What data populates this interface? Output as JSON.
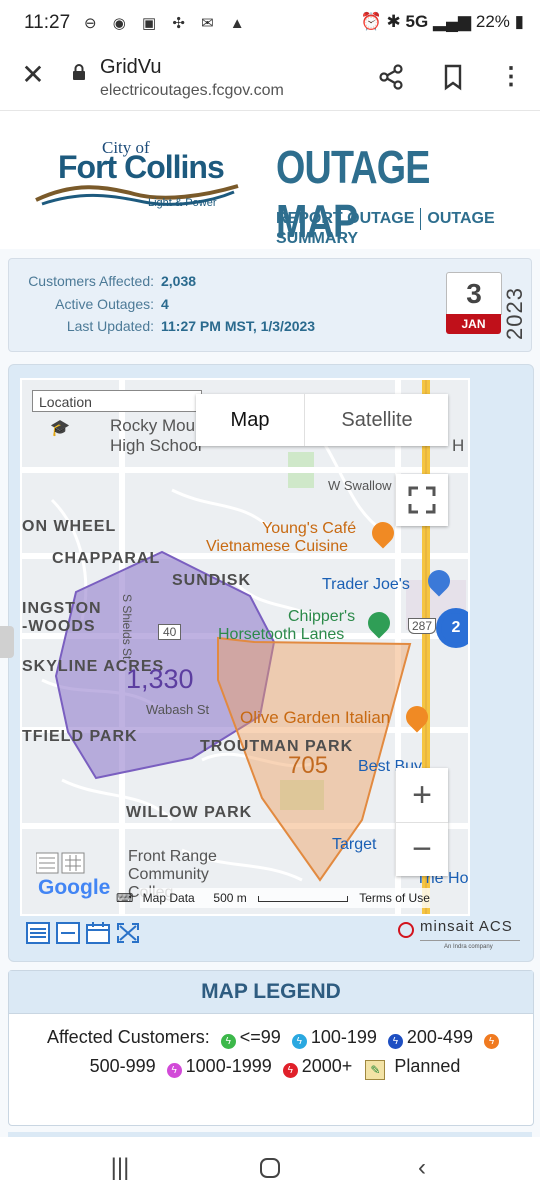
{
  "status_bar": {
    "time": "11:27",
    "network": "5G",
    "battery": "22%"
  },
  "browser": {
    "title": "GridVu",
    "url": "electricoutages.fcgov.com"
  },
  "header": {
    "logo_city": "City of",
    "logo_name": "Fort Collins",
    "logo_sub": "Light & Power",
    "title": "OUTAGE MAP",
    "links": [
      "REPORT OUTAGE",
      "OUTAGE SUMMARY"
    ]
  },
  "summary": {
    "customers_affected_label": "Customers Affected:",
    "customers_affected": "2,038",
    "active_outages_label": "Active Outages:",
    "active_outages": "4",
    "last_updated_label": "Last Updated:",
    "last_updated": "11:27 PM MST, 1/3/2023",
    "calendar_day": "3",
    "calendar_month": "JAN",
    "year": "2023"
  },
  "map": {
    "location_placeholder": "Location",
    "type_map": "Map",
    "type_satellite": "Satellite",
    "zoom_in": "+",
    "zoom_out": "−",
    "outages": [
      {
        "count": "1,330",
        "color": "#8a73c9"
      },
      {
        "count": "705",
        "color": "#f0a060"
      }
    ],
    "cluster_count": "2",
    "labels": {
      "rocky_mountain": "Rocky Mounta",
      "high_school": "High School",
      "w_swallow": "W Swallow R",
      "n_wheel": "ON WHEEL",
      "chapparal": "CHAPPARAL",
      "sundisk": "SUNDISK",
      "ingston": "INGSTON",
      "woods": "-WOODS",
      "skyline": "SKYLINE ACRES",
      "shields": "S Shields St",
      "route40": "40",
      "route287": "287",
      "wabash": "Wabash St",
      "field_park": "TFIELD PARK",
      "troutman": "TROUTMAN PARK",
      "willow": "WILLOW PARK",
      "front_range_1": "Front Range",
      "front_range_2": "Community",
      "front_range_3": "Colleg",
      "the_hom": "The Hom",
      "h_edge": "H"
    },
    "pois": {
      "youngs_1": "Young's Café",
      "youngs_2": "Vietnamese Cuisine",
      "traders": "Trader Joe's",
      "chippers_1": "Chipper's",
      "chippers_2": "Horsetooth Lanes",
      "olive": "Olive Garden Italian",
      "bestbuy": "Best Buy",
      "target": "Target"
    },
    "attribution": {
      "google": "Google",
      "map_data": "Map Data",
      "scale": "500 m",
      "terms": "Terms of Use"
    }
  },
  "brand": {
    "name": "minsait ACS",
    "tagline": "An Indra company"
  },
  "legend": {
    "title": "MAP LEGEND",
    "affected_label": "Affected Customers:",
    "items": [
      {
        "label": "<=99",
        "color": "#3cb84a"
      },
      {
        "label": "100-199",
        "color": "#2aa8e0"
      },
      {
        "label": "200-499",
        "color": "#1e4fc2"
      },
      {
        "label": "500-999",
        "color": "#f07a20"
      },
      {
        "label": "1000-1999",
        "color": "#d24ad8"
      },
      {
        "label": "2000+",
        "color": "#e0202a"
      }
    ],
    "planned_label": "Planned"
  }
}
